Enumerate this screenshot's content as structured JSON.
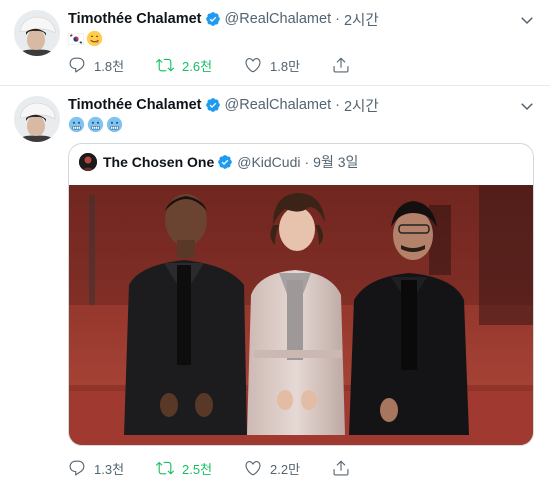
{
  "tweet1": {
    "author_name": "Timothée Chalamet",
    "author_handle": "@RealChalamet",
    "separator": "·",
    "time": "2시간",
    "text_emojis": [
      "south-korea-flag-icon",
      "face-savoring-food-emoji"
    ],
    "actions": {
      "reply_count": "1.8천",
      "retweet_count": "2.6천",
      "like_count": "1.8만"
    }
  },
  "tweet2": {
    "author_name": "Timothée Chalamet",
    "author_handle": "@RealChalamet",
    "separator": "·",
    "time": "2시간",
    "text_emojis": [
      "cold-face-emoji",
      "cold-face-emoji",
      "cold-face-emoji"
    ],
    "quoted": {
      "author_name": "The Chosen One",
      "author_handle": "@KidCudi",
      "separator": "·",
      "date": "9월 3일"
    },
    "actions": {
      "reply_count": "1.3천",
      "retweet_count": "2.5천",
      "like_count": "2.2만"
    }
  },
  "colors": {
    "verified": "#1d9bf0",
    "retweet_active": "#17bf63",
    "muted_text": "#536471",
    "border": "#e6ecf0"
  }
}
